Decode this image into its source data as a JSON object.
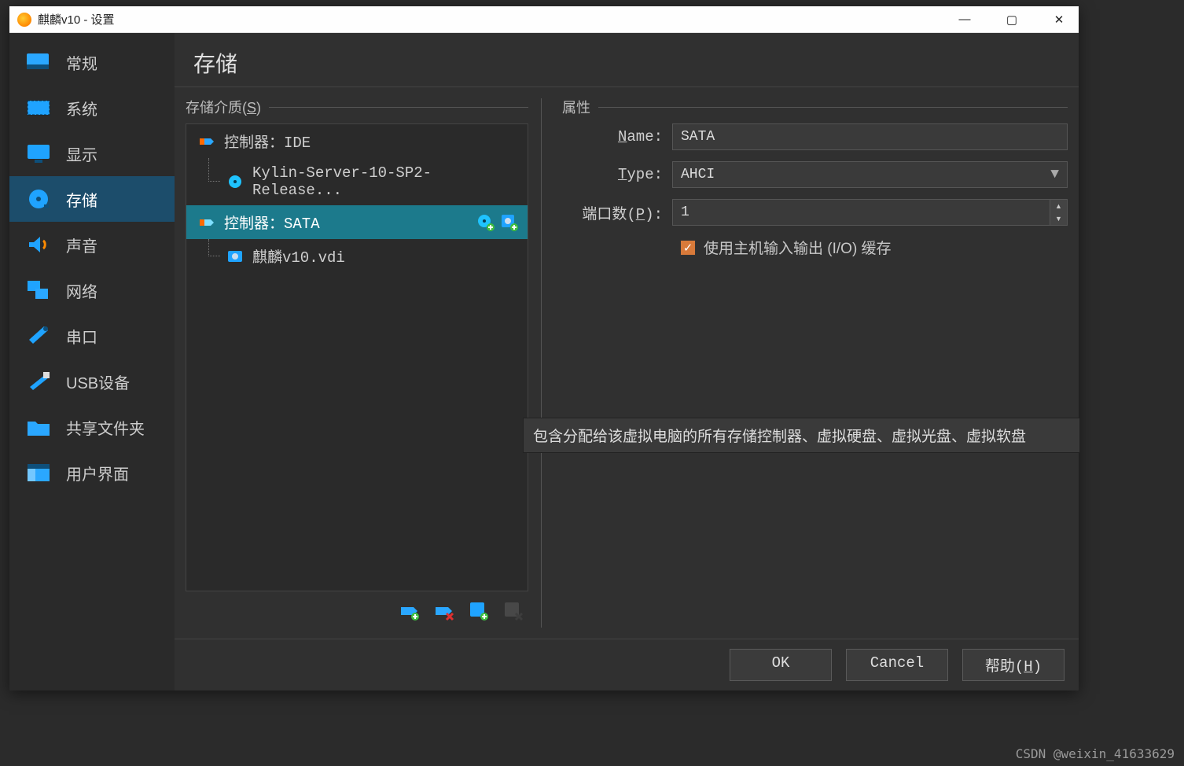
{
  "window": {
    "title": "麒麟v10 - 设置"
  },
  "sidebar": {
    "items": [
      {
        "label": "常规"
      },
      {
        "label": "系统"
      },
      {
        "label": "显示"
      },
      {
        "label": "存储"
      },
      {
        "label": "声音"
      },
      {
        "label": "网络"
      },
      {
        "label": "串口"
      },
      {
        "label": "USB设备"
      },
      {
        "label": "共享文件夹"
      },
      {
        "label": "用户界面"
      }
    ],
    "active_index": 3
  },
  "page": {
    "title": "存储",
    "storage_header": "存储介质(",
    "storage_header_u": "S",
    "storage_header_tail": ")",
    "props_header": "属性",
    "tree": [
      {
        "type": "controller",
        "label": "控制器：IDE"
      },
      {
        "type": "device",
        "label": "Kylin-Server-10-SP2-Release..."
      },
      {
        "type": "controller",
        "label": "控制器：SATA",
        "selected": true
      },
      {
        "type": "device",
        "label": "麒麟v10.vdi"
      }
    ],
    "props": {
      "name_label": "Name:",
      "name_label_u": "N",
      "name_value": "SATA",
      "type_label": "Type:",
      "type_label_u": "T",
      "type_value": "AHCI",
      "ports_label_pre": "端口数(",
      "ports_label_u": "P",
      "ports_label_tail": "):",
      "ports_value": "1",
      "cache_label": "使用主机输入输出 (I/O) 缓存",
      "cache_checked": true
    },
    "tooltip": "包含分配给该虚拟电脑的所有存储控制器、虚拟硬盘、虚拟光盘、虚拟软盘"
  },
  "footer": {
    "ok": "OK",
    "cancel": "Cancel",
    "help": "帮助(",
    "help_u": "H",
    "help_tail": ")"
  },
  "watermark": "CSDN @weixin_41633629"
}
